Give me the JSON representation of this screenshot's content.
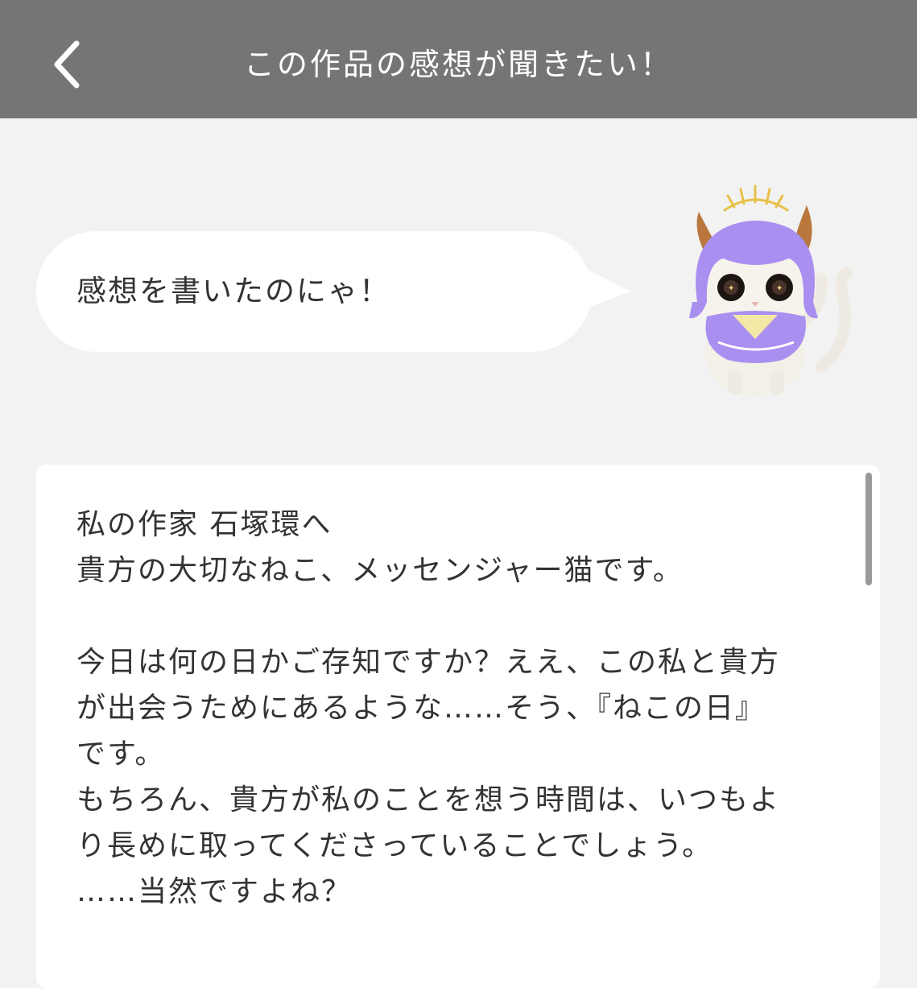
{
  "header": {
    "title": "この作品の感想が聞きたい！",
    "back_icon": "chevron-left-icon"
  },
  "bubble": {
    "text": "感想を書いたのにゃ！"
  },
  "mascot": {
    "icon": "messenger-cat-mascot"
  },
  "message": {
    "lines": [
      "私の作家 石塚環へ",
      "貴方の大切なねこ、メッセンジャー猫です。",
      "",
      "今日は何の日かご存知ですか？ええ、この私と貴方",
      "が出会うためにあるような……そう、『ねこの日』",
      "です。",
      "もちろん、貴方が私のことを想う時間は、いつもよ",
      "り長めに取ってくださっていることでしょう。",
      "……当然ですよね？"
    ]
  },
  "colors": {
    "header_bg": "#757575",
    "page_bg": "#f2f2f2",
    "card_bg": "#ffffff",
    "text": "#333333",
    "mascot_hair": "#a98ff0",
    "mascot_halo": "#e8c14a"
  }
}
